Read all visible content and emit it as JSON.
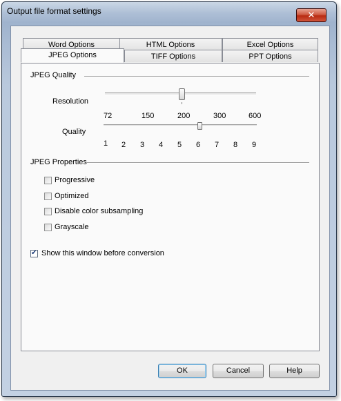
{
  "window": {
    "title": "Output file format settings",
    "close_glyph": "✕"
  },
  "tabs_row_back": [
    {
      "label": "Word Options"
    },
    {
      "label": "HTML Options"
    },
    {
      "label": "Excel Options"
    }
  ],
  "tabs_row_front": [
    {
      "label": "JPEG Options",
      "active": true
    },
    {
      "label": "TIFF Options"
    },
    {
      "label": "PPT Options"
    }
  ],
  "jpeg_quality": {
    "group_label": "JPEG Quality",
    "resolution": {
      "label": "Resolution",
      "ticks": [
        "72",
        "150",
        "200",
        "300",
        "600"
      ],
      "selected": "200"
    },
    "quality": {
      "label": "Quality",
      "ticks": [
        "1",
        "2",
        "3",
        "4",
        "5",
        "6",
        "7",
        "8",
        "9"
      ],
      "selected": "6"
    }
  },
  "jpeg_properties": {
    "group_label": "JPEG Properties",
    "options": [
      {
        "label": "Progressive",
        "checked": false
      },
      {
        "label": "Optimized",
        "checked": false
      },
      {
        "label": "Disable color subsampling",
        "checked": false
      },
      {
        "label": "Grayscale",
        "checked": false
      }
    ]
  },
  "show_window": {
    "label": "Show this window before conversion",
    "checked": true
  },
  "buttons": {
    "ok": "OK",
    "cancel": "Cancel",
    "help": "Help"
  }
}
